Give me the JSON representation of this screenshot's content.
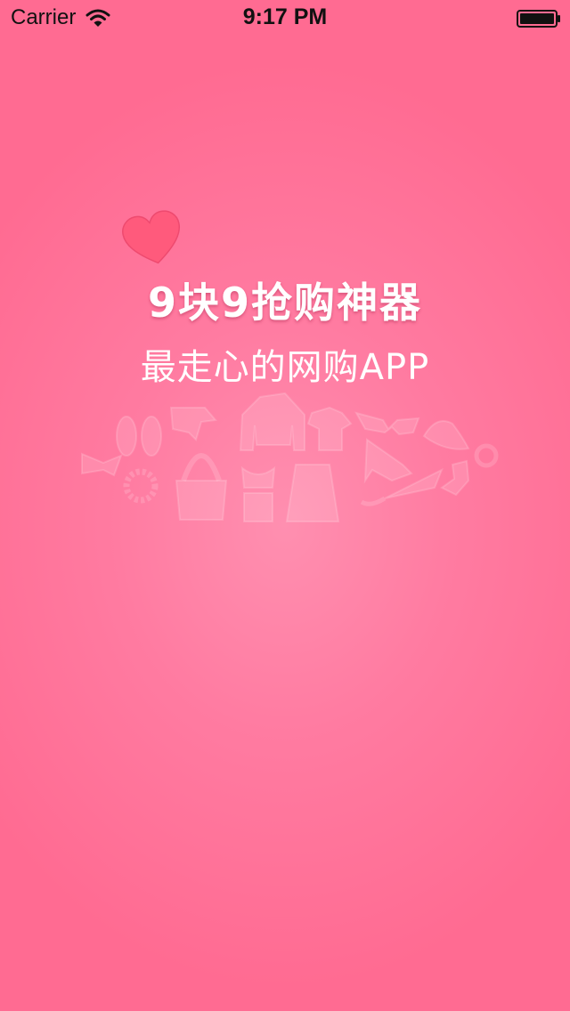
{
  "status_bar": {
    "carrier": "Carrier",
    "time": "9:17 PM"
  },
  "splash": {
    "title": "9块9抢购神器",
    "slogan": "最走心的网购APP"
  },
  "icons": {
    "heart": "heart-icon",
    "wifi": "wifi-icon",
    "battery": "battery-icon",
    "illustration": [
      "flip-flops-icon",
      "high-heel-icon",
      "jacket-icon",
      "tshirt-icon",
      "sunglasses-icon",
      "hat-icon",
      "bow-tie-icon",
      "bracelet-icon",
      "handbag-icon",
      "swimsuit-icon",
      "skirt-icon",
      "stiletto-icon",
      "umbrella-icon",
      "sock-icon",
      "ring-icon"
    ]
  },
  "colors": {
    "background": "#ff6b92",
    "heart": "#ff5a7c",
    "icon_overlay": "#ffffff"
  }
}
